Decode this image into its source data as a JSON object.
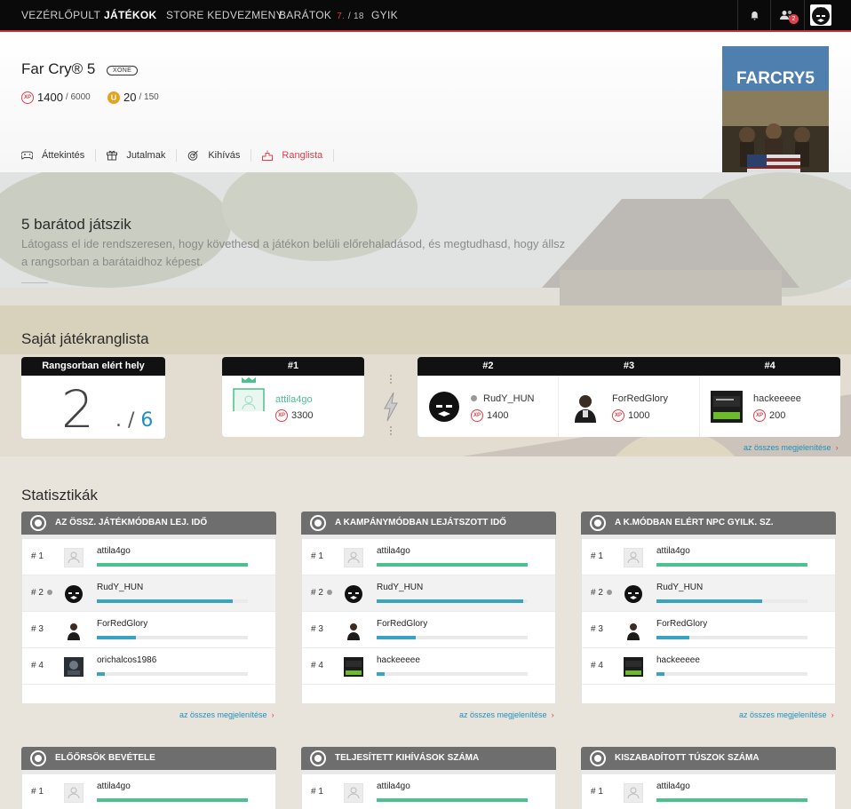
{
  "nav": {
    "items": [
      "VEZÉRLŐPULT",
      "JÁTÉKOK",
      "STORE KEDVEZMENY",
      "BARÁTOK",
      "GYIK"
    ],
    "friends_online": "7.",
    "friends_total": "/ 18",
    "notification_count": "2"
  },
  "game": {
    "title": "Far Cry® 5",
    "platform": "XONE",
    "xp_current": "1400",
    "xp_total": "/ 6000",
    "u_current": "20",
    "u_total": "/ 150",
    "cover_text": "FARCRY5"
  },
  "tabs": [
    "Áttekintés",
    "Jutalmak",
    "Kihívás",
    "Ranglista"
  ],
  "friends_section": {
    "title": "5 barátod játszik",
    "subtitle": "Látogass el ide rendszeresen, hogy követhesd a játékon belüli előrehaladásod, és megtudhasd, hogy állsz a rangsorban a barátaidhoz képest."
  },
  "own_leaderboard": {
    "title": "Saját játékranglista",
    "rank_label": "Rangsorban elért hely",
    "rank": "2",
    "rank_sep": ". /",
    "rank_total": "6",
    "first": {
      "pos": "#1",
      "name": "attila4go",
      "xp": "3300"
    },
    "others": [
      {
        "pos": "#2",
        "name": "RudY_HUN",
        "xp": "1400"
      },
      {
        "pos": "#3",
        "name": "ForRedGlory",
        "xp": "1000"
      },
      {
        "pos": "#4",
        "name": "hackeeeee",
        "xp": "200"
      }
    ],
    "view_all": "az összes megjelenítése"
  },
  "stats": {
    "title": "Statisztikák",
    "view_all": "az összes megjelenítése",
    "panels": [
      {
        "title": "AZ ÖSSZ. JÁTÉKMÓDBAN LEJ. IDŐ",
        "rows": [
          {
            "pos": "# 1",
            "name": "attila4go",
            "fill": 1.0
          },
          {
            "pos": "# 2",
            "name": "RudY_HUN",
            "fill": 0.9
          },
          {
            "pos": "# 3",
            "name": "ForRedGlory",
            "fill": 0.26
          },
          {
            "pos": "# 4",
            "name": "orichalcos1986",
            "fill": 0.05
          }
        ]
      },
      {
        "title": "A KAMPÁNYMÓDBAN LEJÁTSZOTT IDŐ",
        "rows": [
          {
            "pos": "# 1",
            "name": "attila4go",
            "fill": 1.0
          },
          {
            "pos": "# 2",
            "name": "RudY_HUN",
            "fill": 0.97
          },
          {
            "pos": "# 3",
            "name": "ForRedGlory",
            "fill": 0.26
          },
          {
            "pos": "# 4",
            "name": "hackeeeee",
            "fill": 0.05
          }
        ]
      },
      {
        "title": "A K.MÓDBAN ELÉRT NPC GYILK. SZ.",
        "rows": [
          {
            "pos": "# 1",
            "name": "attila4go",
            "fill": 1.0
          },
          {
            "pos": "# 2",
            "name": "RudY_HUN",
            "fill": 0.7
          },
          {
            "pos": "# 3",
            "name": "ForRedGlory",
            "fill": 0.22
          },
          {
            "pos": "# 4",
            "name": "hackeeeee",
            "fill": 0.05
          }
        ]
      },
      {
        "title": "ELŐŐRSÖK BEVÉTELE",
        "rows": [
          {
            "pos": "# 1",
            "name": "attila4go",
            "fill": 1.0
          }
        ]
      },
      {
        "title": "TELJESÍTETT KIHÍVÁSOK SZÁMA",
        "rows": [
          {
            "pos": "# 1",
            "name": "attila4go",
            "fill": 1.0
          }
        ]
      },
      {
        "title": "KISZABADÍTOTT TÚSZOK SZÁMA",
        "rows": [
          {
            "pos": "# 1",
            "name": "attila4go",
            "fill": 1.0
          }
        ]
      }
    ]
  }
}
